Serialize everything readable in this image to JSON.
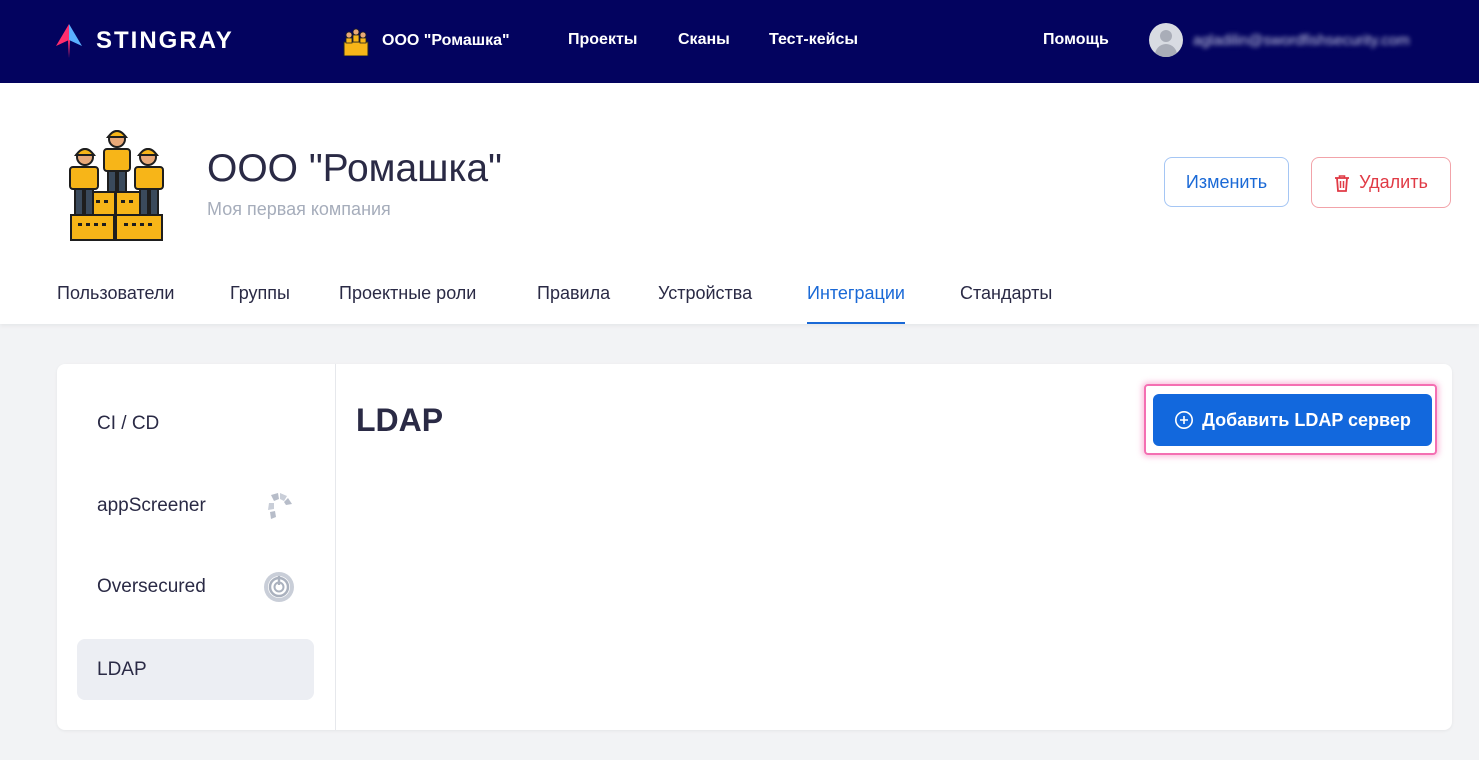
{
  "topbar": {
    "brand": "STINGRAY",
    "org_name": "ООО \"Ромашка\"",
    "nav": [
      "Проекты",
      "Сканы",
      "Тест-кейсы"
    ],
    "help": "Помощь",
    "user_email": "agladilin@swordfishsecurity.com"
  },
  "org": {
    "title": "ООО \"Ромашка\"",
    "description": "Моя первая компания",
    "edit_label": "Изменить",
    "delete_label": "Удалить"
  },
  "tabs": [
    "Пользователи",
    "Группы",
    "Проектные роли",
    "Правила",
    "Устройства",
    "Интеграции",
    "Стандарты"
  ],
  "active_tab": "Интеграции",
  "integrations": {
    "items": [
      {
        "label": "CI / CD",
        "icon": null
      },
      {
        "label": "appScreener",
        "icon": "appscreener-icon"
      },
      {
        "label": "Oversecured",
        "icon": "oversecured-icon"
      },
      {
        "label": "LDAP",
        "icon": null
      }
    ],
    "active": "LDAP",
    "title": "LDAP",
    "add_button": "Добавить LDAP сервер"
  },
  "colors": {
    "navbar": "#03035f",
    "accent": "#1a69d6",
    "danger": "#e03a45",
    "highlight": "#f46fb2"
  }
}
